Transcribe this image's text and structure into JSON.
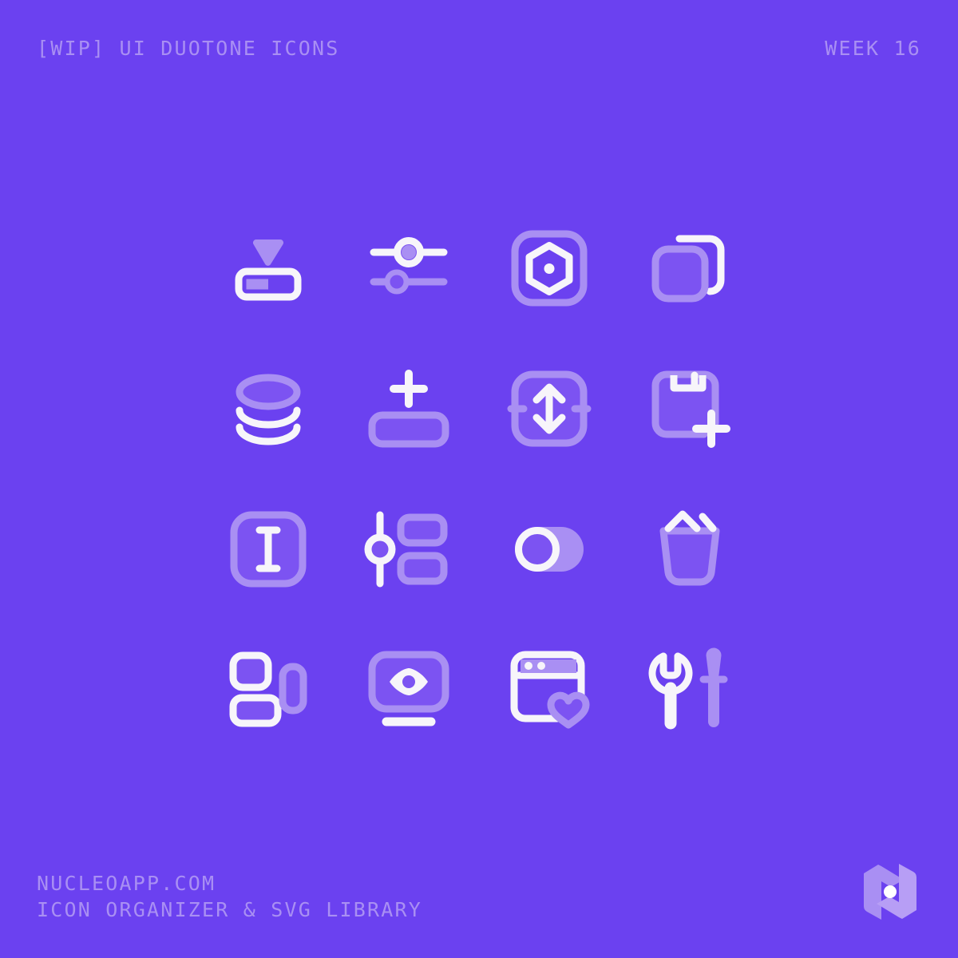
{
  "page": {
    "background_color": "#6B41F0",
    "accent_light": "#A98FF3",
    "icon_white": "#F7F5FA",
    "icon_tint": "#A98FF3",
    "icon_tint_fill": "#7C53F2"
  },
  "header": {
    "title": "[WIP] UI DUOTONE ICONS",
    "week": "WEEK 16"
  },
  "footer": {
    "line1": "NUCLEOAPP.COM",
    "line2": "ICON ORGANIZER & SVG LIBRARY",
    "logo_name": "nucleo-logo"
  },
  "grid": {
    "columns": 4,
    "rows": 4,
    "icons": [
      {
        "id": "slider-progress-icon",
        "label": "Progress bar with drop arrow",
        "row": 1,
        "col": 1
      },
      {
        "id": "sliders-horizontal-icon",
        "label": "Two horizontal sliders",
        "row": 1,
        "col": 2
      },
      {
        "id": "hexagon-settings-icon",
        "label": "Hexagon in rounded square",
        "row": 1,
        "col": 3
      },
      {
        "id": "duplicate-icon",
        "label": "Duplicate squares",
        "row": 1,
        "col": 4
      },
      {
        "id": "database-stack-icon",
        "label": "Database disc stack",
        "row": 2,
        "col": 1
      },
      {
        "id": "add-row-icon",
        "label": "Plus above rounded bar",
        "row": 2,
        "col": 2
      },
      {
        "id": "resize-vertical-icon",
        "label": "Vertical resize arrows in square",
        "row": 2,
        "col": 3
      },
      {
        "id": "save-add-icon",
        "label": "Save floppy with plus",
        "row": 2,
        "col": 4
      },
      {
        "id": "text-cursor-icon",
        "label": "Text I-beam cursor in square",
        "row": 3,
        "col": 1
      },
      {
        "id": "slider-list-icon",
        "label": "Vertical slider with list blocks",
        "row": 3,
        "col": 2
      },
      {
        "id": "toggle-off-icon",
        "label": "Toggle switch off",
        "row": 3,
        "col": 3
      },
      {
        "id": "trash-icon",
        "label": "Trash bin",
        "row": 3,
        "col": 4
      },
      {
        "id": "layout-blocks-icon",
        "label": "Layout blocks arrangement",
        "row": 4,
        "col": 1
      },
      {
        "id": "preview-monitor-icon",
        "label": "Monitor with eye preview",
        "row": 4,
        "col": 2
      },
      {
        "id": "browser-favorite-icon",
        "label": "Browser window with heart",
        "row": 4,
        "col": 3
      },
      {
        "id": "tools-icon",
        "label": "Wrench and screwdriver",
        "row": 4,
        "col": 4
      }
    ]
  }
}
